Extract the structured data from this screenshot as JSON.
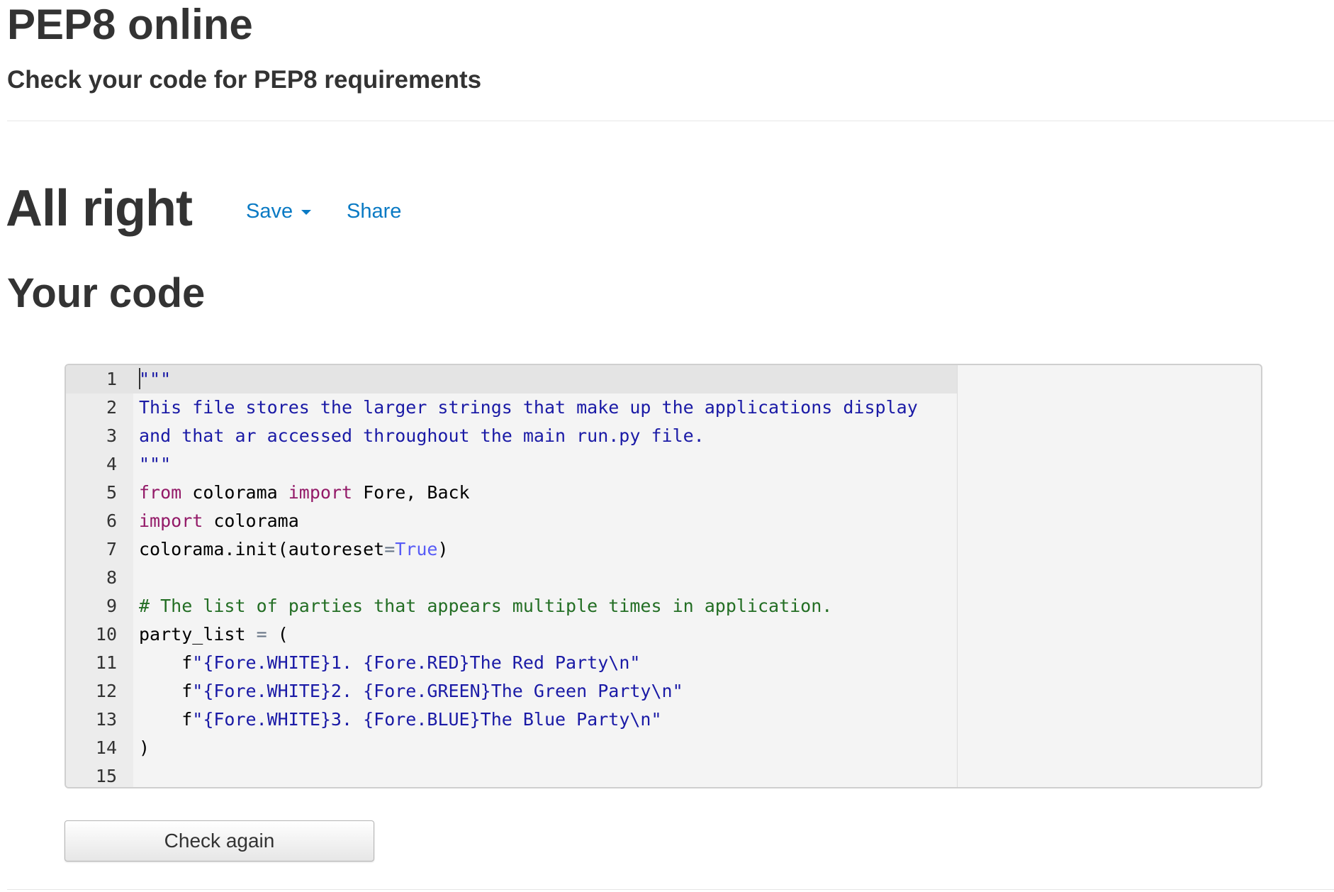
{
  "header": {
    "title": "PEP8 online",
    "subtitle": "Check your code for PEP8 requirements"
  },
  "result": {
    "title": "All right",
    "save_label": "Save",
    "share_label": "Share"
  },
  "code_section": {
    "heading": "Your code"
  },
  "editor": {
    "lines": [
      {
        "num": "1",
        "tokens": [
          {
            "t": "\"\"\"",
            "c": "string"
          }
        ]
      },
      {
        "num": "2",
        "tokens": [
          {
            "t": "This file stores the larger strings that make up the applications display",
            "c": "string"
          }
        ]
      },
      {
        "num": "3",
        "tokens": [
          {
            "t": "and that ar accessed throughout the main run.py file.",
            "c": "string"
          }
        ]
      },
      {
        "num": "4",
        "tokens": [
          {
            "t": "\"\"\"",
            "c": "string"
          }
        ]
      },
      {
        "num": "5",
        "tokens": [
          {
            "t": "from",
            "c": "keyword"
          },
          {
            "t": " colorama ",
            "c": ""
          },
          {
            "t": "import",
            "c": "keyword"
          },
          {
            "t": " Fore, Back",
            "c": ""
          }
        ]
      },
      {
        "num": "6",
        "tokens": [
          {
            "t": "import",
            "c": "keyword"
          },
          {
            "t": " colorama",
            "c": ""
          }
        ]
      },
      {
        "num": "7",
        "tokens": [
          {
            "t": "colorama.init(autoreset",
            "c": ""
          },
          {
            "t": "=",
            "c": "op"
          },
          {
            "t": "True",
            "c": "const"
          },
          {
            "t": ")",
            "c": ""
          }
        ]
      },
      {
        "num": "8",
        "tokens": []
      },
      {
        "num": "9",
        "tokens": [
          {
            "t": "# The list of parties that appears multiple times in application.",
            "c": "comment"
          }
        ]
      },
      {
        "num": "10",
        "tokens": [
          {
            "t": "party_list ",
            "c": ""
          },
          {
            "t": "=",
            "c": "op"
          },
          {
            "t": " (",
            "c": ""
          }
        ]
      },
      {
        "num": "11",
        "tokens": [
          {
            "t": "    f",
            "c": ""
          },
          {
            "t": "\"{Fore.WHITE}1. {Fore.RED}The Red Party\\n\"",
            "c": "string"
          }
        ]
      },
      {
        "num": "12",
        "tokens": [
          {
            "t": "    f",
            "c": ""
          },
          {
            "t": "\"{Fore.WHITE}2. {Fore.GREEN}The Green Party\\n\"",
            "c": "string"
          }
        ]
      },
      {
        "num": "13",
        "tokens": [
          {
            "t": "    f",
            "c": ""
          },
          {
            "t": "\"{Fore.WHITE}3. {Fore.BLUE}The Blue Party\\n\"",
            "c": "string"
          }
        ]
      },
      {
        "num": "14",
        "tokens": [
          {
            "t": ")",
            "c": ""
          }
        ]
      },
      {
        "num": "15",
        "tokens": []
      }
    ]
  },
  "actions": {
    "check_again_label": "Check again"
  },
  "colors": {
    "link": "#0a7ac4",
    "string": "#1a1aa6",
    "keyword": "#931a68",
    "comment": "#236e24",
    "constant": "#585cf6"
  }
}
